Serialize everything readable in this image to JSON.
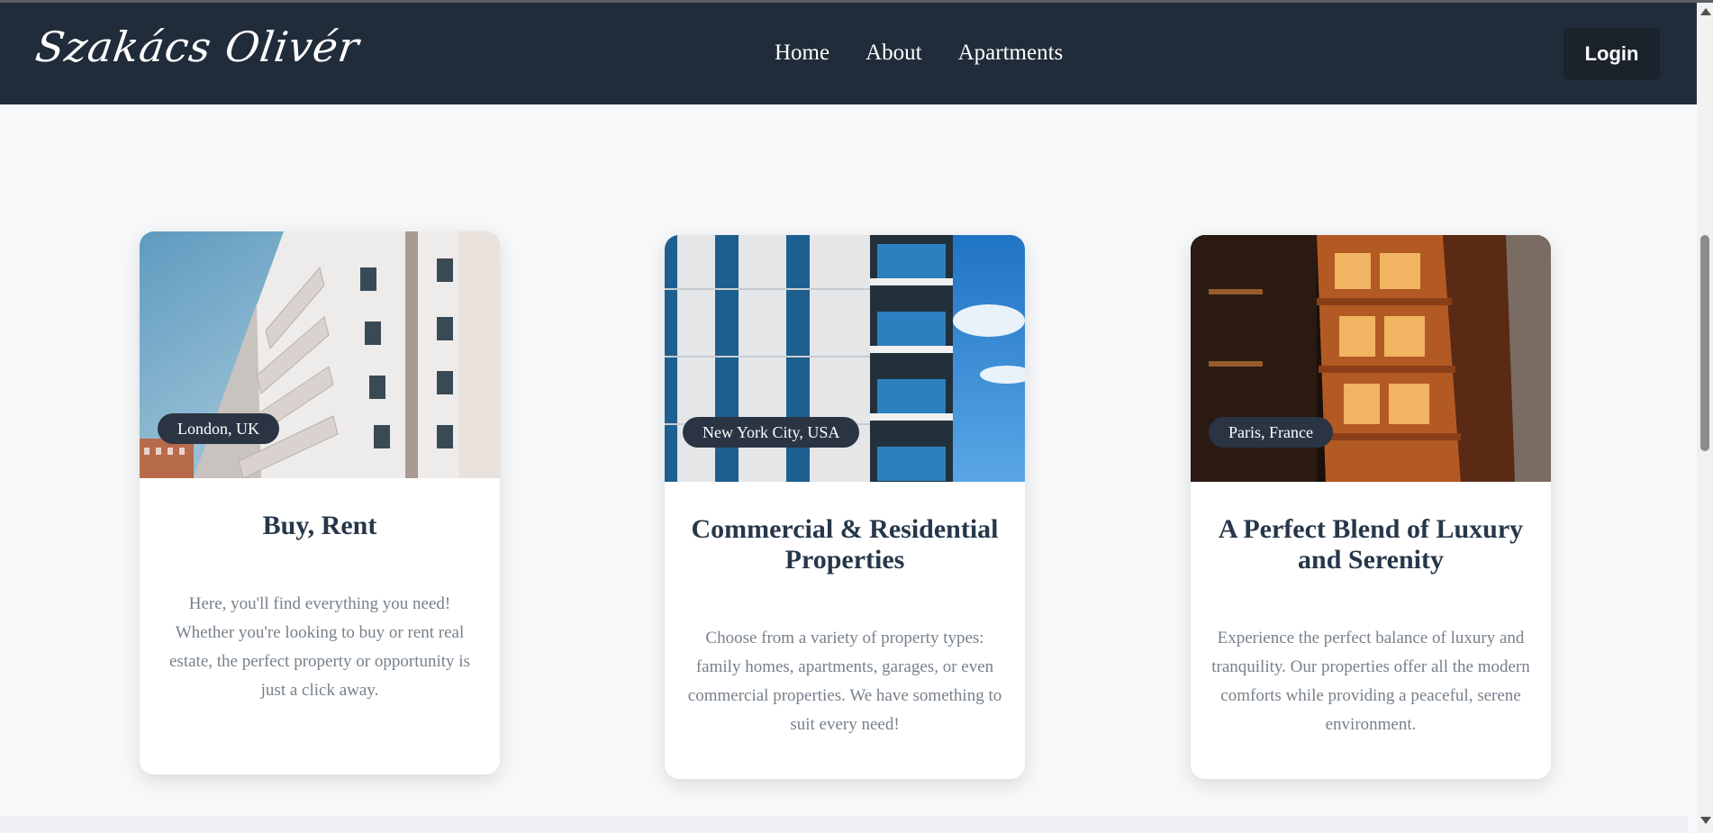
{
  "header": {
    "logo": "Szakács Olivér",
    "nav": [
      {
        "label": "Home"
      },
      {
        "label": "About"
      },
      {
        "label": "Apartments"
      }
    ],
    "login_label": "Login"
  },
  "cards": [
    {
      "location": "London, UK",
      "title": "Buy, Rent",
      "text": "Here, you'll find everything you need! Whether you're looking to buy or rent real estate, the perfect property or opportunity is just a click away."
    },
    {
      "location": "New York City, USA",
      "title": "Commercial & Residential Properties",
      "text": "Choose from a variety of property types: family homes, apartments, garages, or even commercial properties. We have something to suit every need!"
    },
    {
      "location": "Paris, France",
      "title": "A Perfect Blend of Luxury and Serenity",
      "text": "Experience the perfect balance of luxury and tranquility. Our properties offer all the modern comforts while providing a peaceful, serene environment."
    }
  ],
  "colors": {
    "navbar": "#212c3a",
    "login_button": "#1a222c",
    "page_background": "#f7f8fa",
    "title_text": "#27374a",
    "body_text": "#77818b"
  }
}
